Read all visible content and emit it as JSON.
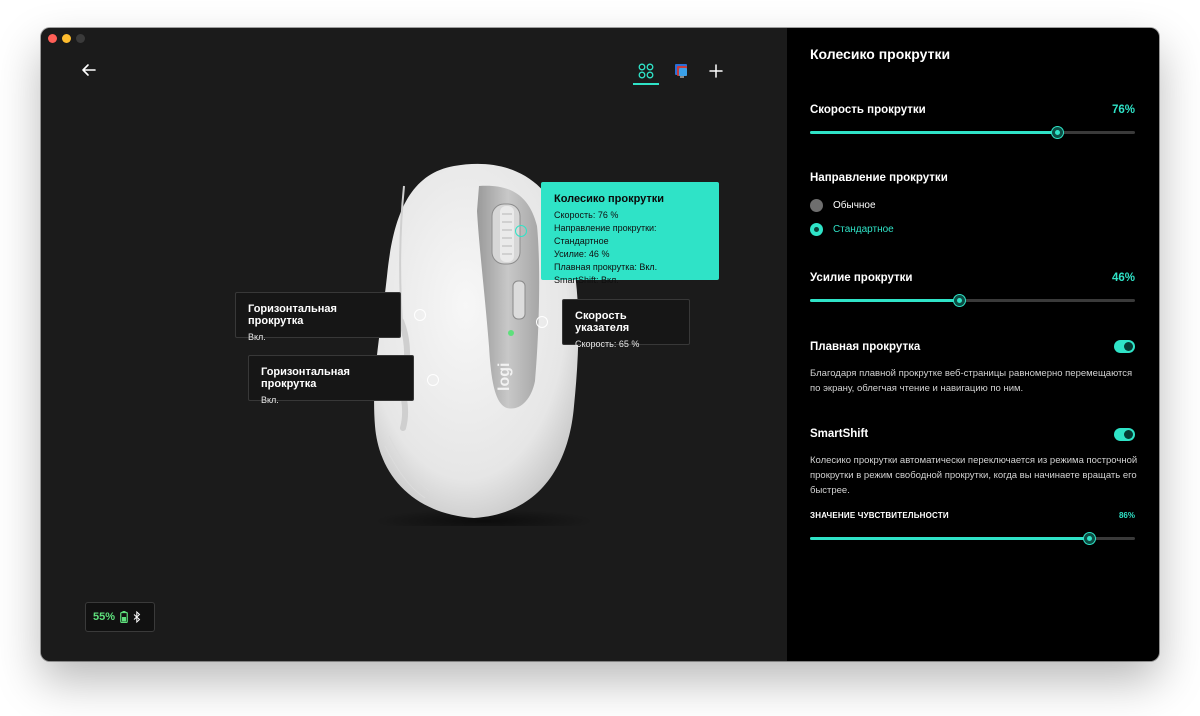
{
  "window": {
    "traffic_lights": {
      "close": "#ff5f57",
      "minimize": "#febc2e",
      "zoom": "#3a3a3a"
    }
  },
  "toolbar": {
    "back_icon": "arrow-left-icon",
    "icons": [
      "buttons-grid-icon",
      "app-settings-icon",
      "plus-icon"
    ],
    "active_icon": "buttons-grid-icon"
  },
  "callouts": {
    "scroll_wheel": {
      "title": "Колесико прокрутки",
      "lines": [
        "Скорость: 76 %",
        "Направление прокрутки: Стандартное",
        "Усилие: 46 %",
        "Плавная прокрутка: Вкл.",
        "SmartShift: Вкл."
      ]
    },
    "horizontal_1": {
      "title": "Горизонтальная прокрутка",
      "value": "Вкл."
    },
    "horizontal_2": {
      "title": "Горизонтальная прокрутка",
      "value": "Вкл."
    },
    "pointer_speed": {
      "title": "Скорость указателя",
      "value": "Скорость: 65 %"
    }
  },
  "battery": {
    "percent": "55%",
    "icons": [
      "battery-icon",
      "bluetooth-icon"
    ]
  },
  "mouse": {
    "logo_text": "logi"
  },
  "sidebar": {
    "title": "Колесико прокрутки",
    "scroll_speed": {
      "label": "Скорость прокрутки",
      "value": "76%",
      "level": 76
    },
    "direction": {
      "label": "Направление прокрутки",
      "options": [
        "Обычное",
        "Стандартное"
      ],
      "selected": "Стандартное"
    },
    "scroll_force": {
      "label": "Усилие прокрутки",
      "value": "46%",
      "level": 46
    },
    "smooth_scroll": {
      "label": "Плавная прокрутка",
      "enabled": true,
      "description": "Благодаря плавной прокрутке веб-страницы равномерно перемещаются по экрану, облегчая чтение и навигацию по ним."
    },
    "smartshift": {
      "label": "SmartShift",
      "enabled": true,
      "description": "Колесико прокрутки автоматически переключается из режима построчной прокрутки в режим свободной прокрутки, когда вы начинаете вращать его быстрее.",
      "sensitivity_label": "ЗНАЧЕНИЕ ЧУВСТВИТЕЛЬНОСТИ",
      "sensitivity_value": "86%",
      "level": 86
    }
  },
  "colors": {
    "accent": "#2fe3c7",
    "battery_green": "#5ee07c",
    "sidebar_bg": "#000000",
    "main_bg": "#1b1b1b"
  }
}
